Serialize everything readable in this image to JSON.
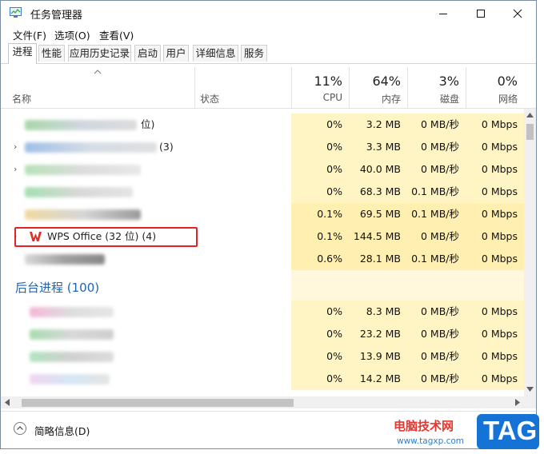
{
  "window": {
    "title": "任务管理器"
  },
  "menu": [
    "文件(F)",
    "选项(O)",
    "查看(V)"
  ],
  "tabs": [
    "进程",
    "性能",
    "应用历史记录",
    "启动",
    "用户",
    "详细信息",
    "服务"
  ],
  "active_tab": "进程",
  "columns": {
    "name": "名称",
    "status": "状态",
    "cpu": {
      "percent": "11%",
      "label": "CPU"
    },
    "memory": {
      "percent": "64%",
      "label": "内存"
    },
    "disk": {
      "percent": "3%",
      "label": "磁盘"
    },
    "network": {
      "percent": "0%",
      "label": "网络"
    }
  },
  "rows": [
    {
      "name_suffix": "位)",
      "cpu": "0%",
      "mem": "3.2 MB",
      "disk": "0 MB/秒",
      "net": "0 Mbps"
    },
    {
      "name_suffix": "(3)",
      "cpu": "0%",
      "mem": "3.3 MB",
      "disk": "0 MB/秒",
      "net": "0 Mbps"
    },
    {
      "name_suffix": "",
      "cpu": "0%",
      "mem": "40.0 MB",
      "disk": "0 MB/秒",
      "net": "0 Mbps"
    },
    {
      "name_suffix": "",
      "cpu": "0%",
      "mem": "68.3 MB",
      "disk": "0.1 MB/秒",
      "net": "0 Mbps"
    },
    {
      "name_suffix": "",
      "cpu": "0.1%",
      "mem": "69.5 MB",
      "disk": "0.1 MB/秒",
      "net": "0 Mbps"
    },
    {
      "name": "WPS Office (32 位) (4)",
      "cpu": "0.1%",
      "mem": "144.5 MB",
      "disk": "0 MB/秒",
      "net": "0 Mbps"
    },
    {
      "name_suffix": "",
      "cpu": "0.6%",
      "mem": "28.1 MB",
      "disk": "0.1 MB/秒",
      "net": "0 Mbps"
    }
  ],
  "background_group": "后台进程 (100)",
  "bg_rows": [
    {
      "cpu": "0%",
      "mem": "8.3 MB",
      "disk": "0 MB/秒",
      "net": "0 Mbps"
    },
    {
      "cpu": "0%",
      "mem": "23.2 MB",
      "disk": "0 MB/秒",
      "net": "0 Mbps"
    },
    {
      "cpu": "0%",
      "mem": "13.9 MB",
      "disk": "0 MB/秒",
      "net": "0 Mbps"
    },
    {
      "cpu": "0%",
      "mem": "14.2 MB",
      "disk": "0 MB/秒",
      "net": "0 Mbps"
    }
  ],
  "footer": {
    "label": "简略信息(D)"
  },
  "watermark": {
    "site": "电脑技术网",
    "url": "www.tagxp.com",
    "tag": "TAG"
  }
}
